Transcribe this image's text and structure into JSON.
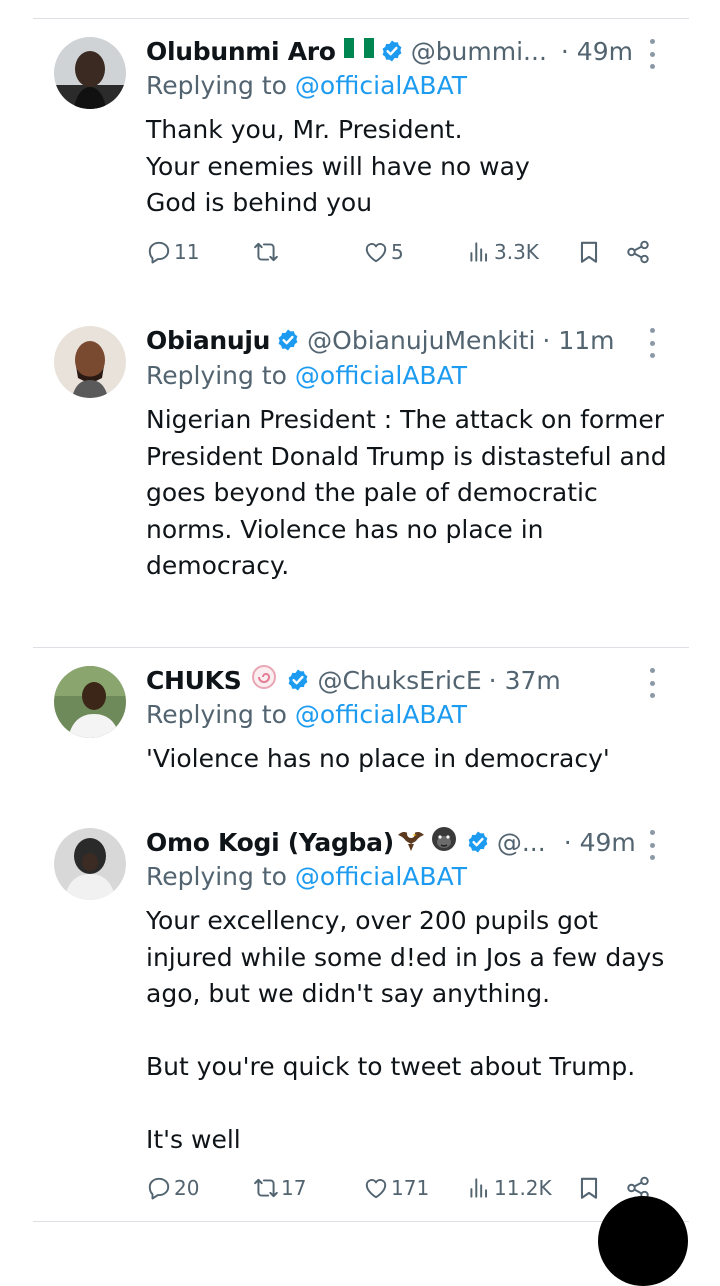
{
  "tweets": [
    {
      "name": "Olubunmi Aro",
      "flag_emoji": "🇳🇬",
      "handle": "@bummi...",
      "time": "· 49m",
      "reply_prefix": "Replying to",
      "reply_to": "@officialABAT",
      "text": "Thank you, Mr. President.\nYour enemies will have no way\nGod is behind you",
      "replies": "11",
      "reposts": "",
      "likes": "5",
      "views": "3.3K"
    },
    {
      "name": "Obianuju",
      "handle": "@ObianujuMenkiti",
      "time": "· 11m",
      "reply_prefix": "Replying to",
      "reply_to": "@officialABAT",
      "text": "Nigerian President : The attack on former President Donald Trump is distasteful and goes beyond the pale of democratic norms. Violence has no place in democracy."
    },
    {
      "name": "CHUKS",
      "name_emoji": "🍥",
      "handle": "@ChuksEricE",
      "time": "· 37m",
      "reply_prefix": "Replying to",
      "reply_to": "@officialABAT",
      "text": "'Violence has no place in democracy'"
    },
    {
      "name": "Omo Kogi (Yagba)",
      "name_emojis": "🦅🦍",
      "handle": "@...",
      "time": "· 49m",
      "reply_prefix": "Replying to",
      "reply_to": "@officialABAT",
      "text_lines": [
        "Your excellency, over 200 pupils got injured while some d!ed in Jos a few days ago, but we didn't say anything.",
        "But you're quick to tweet about Trump.",
        "It's well"
      ],
      "replies": "20",
      "reposts": "17",
      "likes": "171",
      "views": "11.2K"
    }
  ],
  "icons": {
    "verified": "verified-badge-icon",
    "more": "more-vertical-icon",
    "reply": "reply-bubble-icon",
    "repost": "repost-icon",
    "like": "heart-icon",
    "views": "analytics-bars-icon",
    "bookmark": "bookmark-icon",
    "share": "share-icon"
  },
  "colors": {
    "text": "#0f1419",
    "secondary": "#536471",
    "link": "#1d9bf0",
    "verified": "#1d9bf0",
    "divider": "#dcdfe3"
  }
}
